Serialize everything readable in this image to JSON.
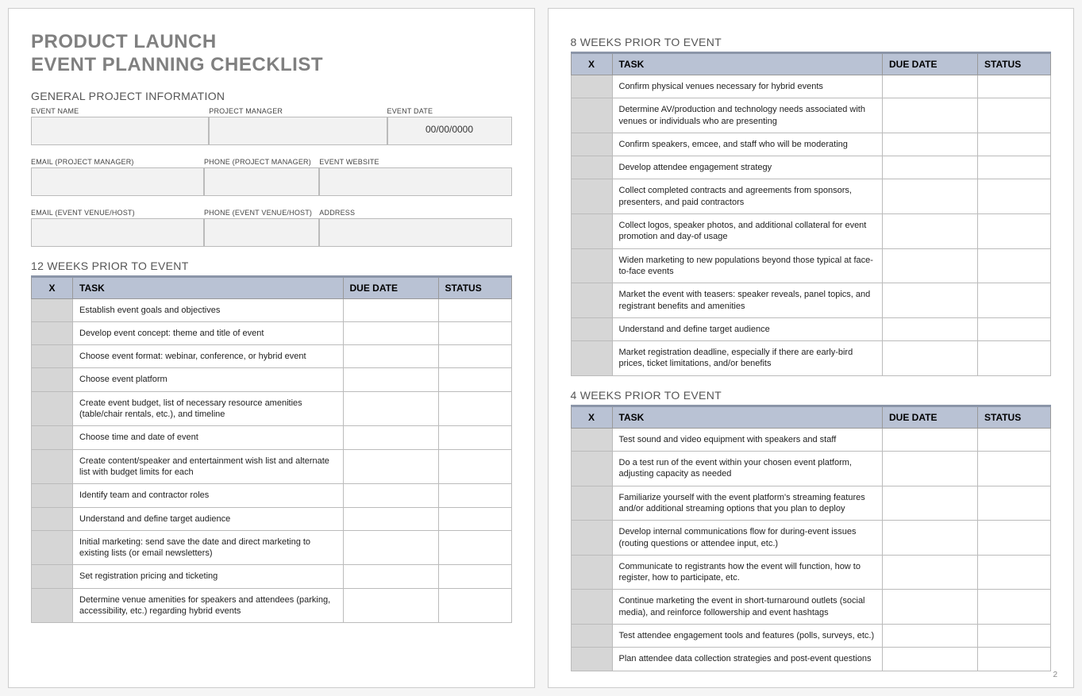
{
  "title_line1": "PRODUCT LAUNCH",
  "title_line2": "EVENT PLANNING CHECKLIST",
  "sections": {
    "general": "GENERAL PROJECT INFORMATION",
    "w12": "12 WEEKS PRIOR TO EVENT",
    "w8": "8 WEEKS PRIOR TO EVENT",
    "w4": "4 WEEKS PRIOR TO EVENT"
  },
  "info_labels": {
    "event_name": "EVENT NAME",
    "project_manager": "PROJECT MANAGER",
    "event_date": "EVENT DATE",
    "email_pm": "EMAIL (PROJECT MANAGER)",
    "phone_pm": "PHONE (PROJECT MANAGER)",
    "website": "EVENT WEBSITE",
    "email_venue": "EMAIL (EVENT VENUE/HOST)",
    "phone_venue": "PHONE (EVENT VENUE/HOST)",
    "address": "ADDRESS"
  },
  "info_values": {
    "event_name": "",
    "project_manager": "",
    "event_date": "00/00/0000",
    "email_pm": "",
    "phone_pm": "",
    "website": "",
    "email_venue": "",
    "phone_venue": "",
    "address": ""
  },
  "table_headers": {
    "x": "X",
    "task": "TASK",
    "due": "DUE DATE",
    "status": "STATUS"
  },
  "tasks_12": [
    "Establish event goals and objectives",
    "Develop event concept: theme and title of event",
    "Choose event format: webinar, conference, or hybrid event",
    "Choose event platform",
    "Create event budget, list of necessary resource amenities (table/chair rentals, etc.), and timeline",
    "Choose time and date of event",
    "Create content/speaker and entertainment wish list and alternate list with budget limits for each",
    "Identify team and contractor roles",
    "Understand and define target audience",
    "Initial marketing: send save the date and direct marketing to existing lists (or email newsletters)",
    "Set registration pricing and ticketing",
    "Determine venue amenities for speakers and attendees (parking, accessibility, etc.) regarding hybrid events"
  ],
  "tasks_8": [
    "Confirm physical venues necessary for hybrid events",
    "Determine AV/production and technology needs associated with venues or individuals who are presenting",
    "Confirm speakers, emcee, and staff who will be moderating",
    "Develop attendee engagement strategy",
    "Collect completed contracts and agreements from sponsors, presenters, and paid contractors",
    "Collect logos, speaker photos, and additional collateral for event promotion and day-of usage",
    "Widen marketing to new populations beyond those typical at face-to-face events",
    "Market the event with teasers: speaker reveals, panel topics, and registrant benefits and amenities",
    "Understand and define target audience",
    "Market registration deadline, especially if there are early-bird prices, ticket limitations, and/or benefits"
  ],
  "tasks_4": [
    "Test sound and video equipment with speakers and staff",
    "Do a test run of the event within your chosen event platform, adjusting capacity as needed",
    "Familiarize yourself with the event platform's streaming features and/or additional streaming options that you plan to deploy",
    "Develop internal communications flow for during-event issues (routing questions or attendee input, etc.)",
    "Communicate to registrants how the event will function, how to register, how to participate, etc.",
    "Continue marketing the event in short-turnaround outlets (social media), and reinforce followership and event hashtags",
    "Test attendee engagement tools and features (polls, surveys, etc.)",
    "Plan attendee data collection strategies and post-event questions"
  ],
  "page_number": "2"
}
